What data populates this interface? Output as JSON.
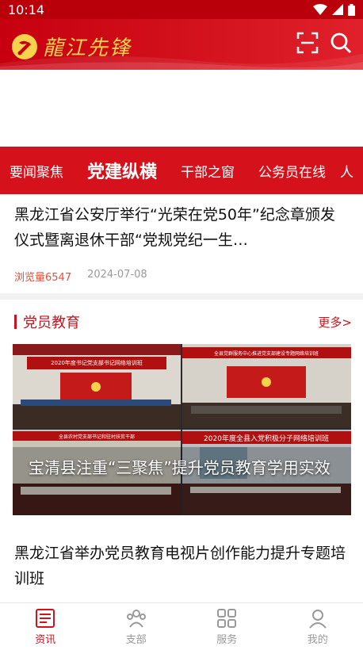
{
  "status_bar": {
    "time": "10:14"
  },
  "header": {
    "logo_text": "龍江先锋"
  },
  "tabs": [
    {
      "label": "要闻聚焦"
    },
    {
      "label": "党建纵横"
    },
    {
      "label": "干部之窗"
    },
    {
      "label": "公务员在线"
    },
    {
      "label": "人"
    }
  ],
  "article1": {
    "title": "黑龙江省公安厅举行“光荣在党50年”纪念章颁发仪式暨离退休干部“党规党纪一生…",
    "views": "浏览量6547",
    "date": "2024-07-08"
  },
  "section": {
    "title": "党员教育",
    "more": "更多>"
  },
  "feature": {
    "caption": "宝清县注重“三聚焦”提升党员教育学用实效",
    "banners": [
      "2020年度书记党支部书记网络培训班",
      "全县党群服务中心推进党支部建设专题网络培训班",
      "全县农村党支部书记和驻村扶贫干部",
      "2020年度全县入党积极分子网络培训班"
    ]
  },
  "article2": {
    "title": "黑龙江省举办党员教育电视片创作能力提升专题培训班"
  },
  "bottom_nav": [
    {
      "label": "资讯",
      "icon": "news-icon"
    },
    {
      "label": "支部",
      "icon": "branch-icon"
    },
    {
      "label": "服务",
      "icon": "services-icon"
    },
    {
      "label": "我的",
      "icon": "profile-icon"
    }
  ],
  "colors": {
    "primary": "#d5121c",
    "accent": "#c8141e",
    "gold": "#f6d34a"
  }
}
